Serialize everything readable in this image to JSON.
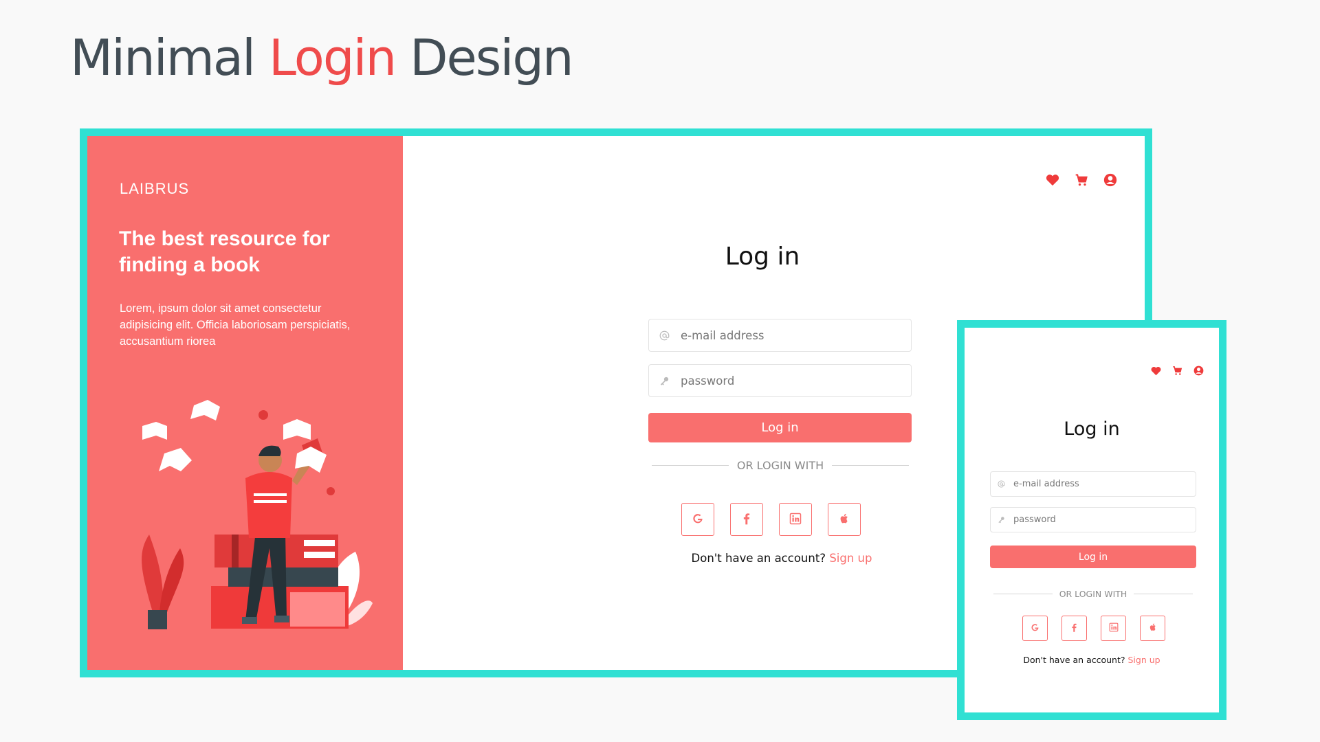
{
  "page": {
    "title_part1": "Minimal",
    "title_accent": "Login",
    "title_part2": "Design"
  },
  "colors": {
    "accent": "#f96f6e",
    "frame": "#30e0d3",
    "heading": "#424d55"
  },
  "desktop": {
    "brand": "LAIBRUS",
    "tagline": "The best resource for finding a book",
    "blurb": "Lorem, ipsum dolor sit amet consectetur adipisicing elit. Officia laboriosam perspiciatis, accusantium riorea",
    "top_icons": [
      "heart-icon",
      "cart-icon",
      "user-circle-icon"
    ],
    "heading": "Log in",
    "email_placeholder": "e-mail address",
    "password_placeholder": "password",
    "login_button": "Log in",
    "divider": "OR LOGIN WITH",
    "social": [
      "google-icon",
      "facebook-icon",
      "linkedin-icon",
      "apple-icon"
    ],
    "signup_prompt": "Don't have an account?",
    "signup_link": "Sign up"
  },
  "mobile": {
    "top_icons": [
      "heart-icon",
      "cart-icon",
      "user-circle-icon"
    ],
    "heading": "Log in",
    "email_placeholder": "e-mail address",
    "password_placeholder": "password",
    "login_button": "Log in",
    "divider": "OR LOGIN WITH",
    "social": [
      "google-icon",
      "facebook-icon",
      "linkedin-icon",
      "apple-icon"
    ],
    "signup_prompt": "Don't have an account?",
    "signup_link": "Sign up"
  }
}
